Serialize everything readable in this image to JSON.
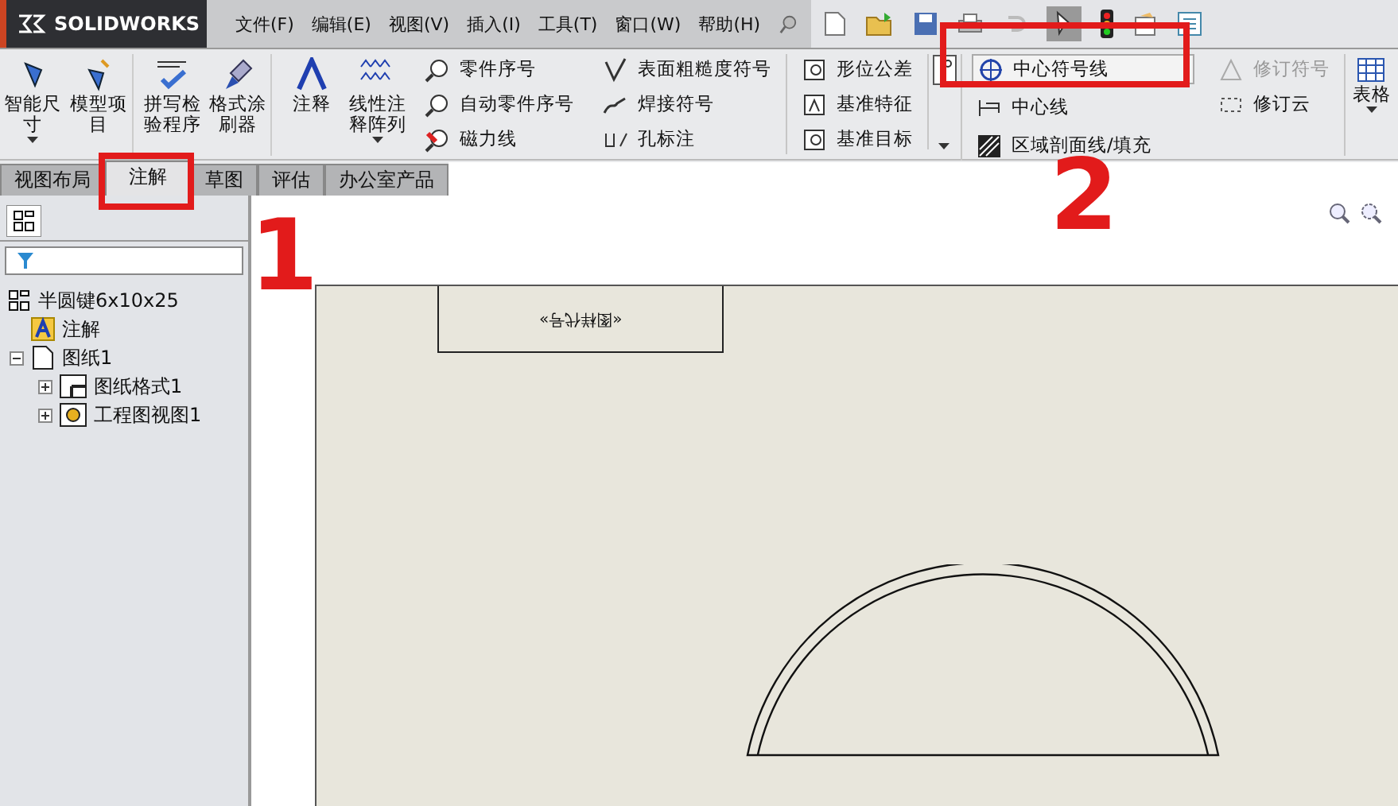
{
  "app": {
    "logo": "SOLIDWORKS"
  },
  "menu": [
    "文件(F)",
    "编辑(E)",
    "视图(V)",
    "插入(I)",
    "工具(T)",
    "窗口(W)",
    "帮助(H)"
  ],
  "ribbon": {
    "large": [
      {
        "label": "智能尺寸",
        "caret": true
      },
      {
        "label": "模型项目",
        "caret": false
      },
      {
        "label": "拼写检验程序",
        "caret": false
      },
      {
        "label": "格式涂刷器",
        "caret": false
      },
      {
        "label": "注释",
        "caret": false
      },
      {
        "label": "线性注释阵列",
        "caret": true
      }
    ],
    "col1": [
      "零件序号",
      "自动零件序号",
      "磁力线"
    ],
    "col2": [
      "表面粗糙度符号",
      "焊接符号",
      "孔标注"
    ],
    "col3": [
      "形位公差",
      "基准特征",
      "基准目标"
    ],
    "col4": [
      {
        "label": "中心符号线",
        "selected": true
      },
      {
        "label": "中心线",
        "selected": false
      },
      {
        "label": "区域剖面线/填充",
        "selected": false
      }
    ],
    "col5": [
      {
        "label": "修订符号",
        "disabled": true
      },
      {
        "label": "修订云",
        "disabled": false
      }
    ],
    "table": "表格"
  },
  "tabs": [
    {
      "label": "视图布局",
      "selected": false
    },
    {
      "label": "注解",
      "selected": true
    },
    {
      "label": "草图",
      "selected": false
    },
    {
      "label": "评估",
      "selected": false
    },
    {
      "label": "办公室产品",
      "selected": false
    }
  ],
  "tree": {
    "root": "半圆键6x10x25",
    "children": [
      {
        "label": "注解"
      },
      {
        "label": "图纸1",
        "expanded": true,
        "children": [
          {
            "label": "图纸格式1",
            "expanded": false
          },
          {
            "label": "工程图视图1",
            "expanded": false
          }
        ]
      }
    ]
  },
  "sheet": {
    "title_block": "«图样代号»"
  },
  "annotations": [
    "1",
    "2"
  ]
}
